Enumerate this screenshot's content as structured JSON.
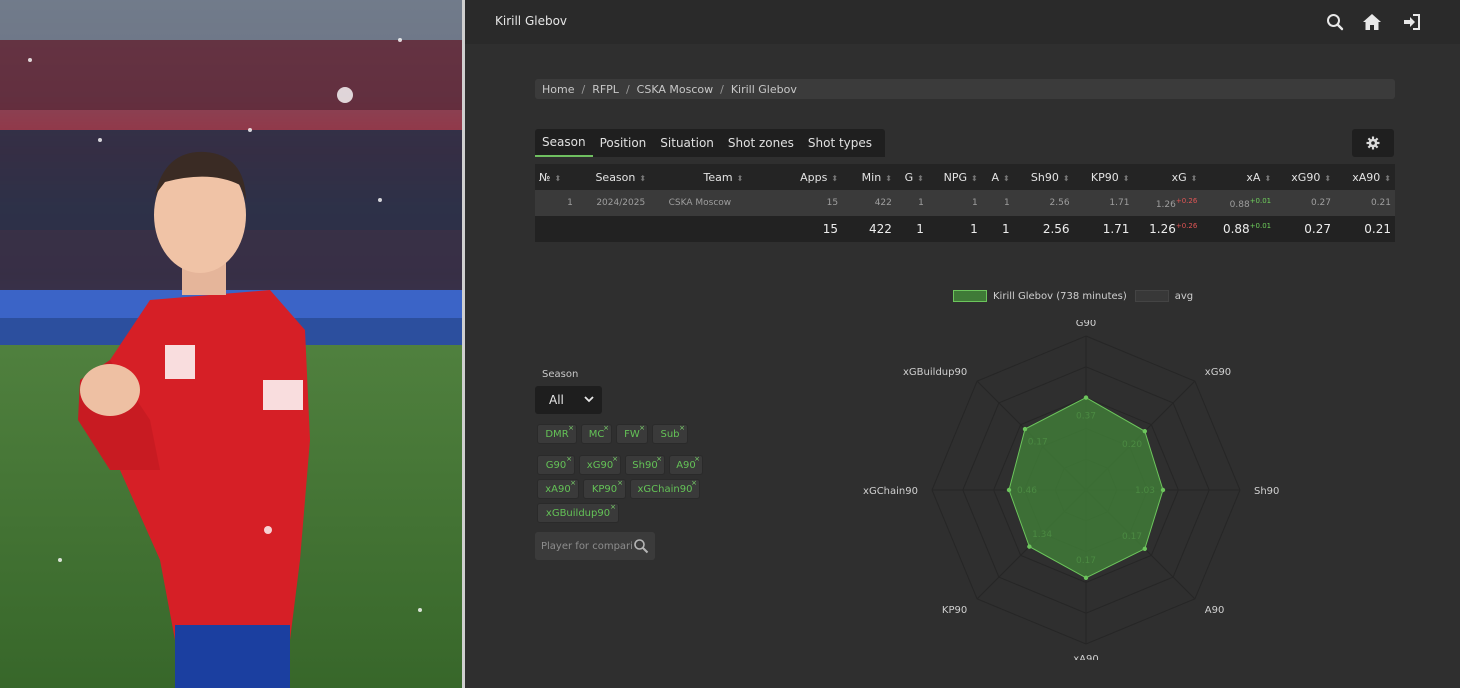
{
  "app": {
    "title": "Kirill Glebov"
  },
  "icons": {
    "search": "search-icon",
    "home": "home-icon",
    "login": "login-icon",
    "settings": "gear-icon",
    "chevron": "chevron-down-icon"
  },
  "colors": {
    "accent": "#6fbf60",
    "radar_fill": "#3f7a37",
    "radar_stroke": "#6cc55c",
    "background": "#2f2f2f",
    "negative": "#e05555"
  },
  "breadcrumb": [
    "Home",
    "RFPL",
    "CSKA Moscow",
    "Kirill Glebov"
  ],
  "breadcrumb_separator": "/",
  "tabs": [
    "Season",
    "Position",
    "Situation",
    "Shot zones",
    "Shot types"
  ],
  "active_tab": "Season",
  "table": {
    "columns": [
      "№",
      "Season",
      "Team",
      "Apps",
      "Min",
      "G",
      "NPG",
      "A",
      "Sh90",
      "KP90",
      "xG",
      "xA",
      "xG90",
      "xA90"
    ],
    "rows": [
      {
        "num": "1",
        "season": "2024/2025",
        "team": "CSKA Moscow",
        "apps": "15",
        "min": "422",
        "g": "1",
        "npg": "1",
        "a": "1",
        "sh90": "2.56",
        "kp90": "1.71",
        "xg": "1.26",
        "xg_diff": "+0.26",
        "xa": "0.88",
        "xa_diff": "+0.01",
        "xg90": "0.27",
        "xa90": "0.21"
      }
    ],
    "total": {
      "apps": "15",
      "min": "422",
      "g": "1",
      "npg": "1",
      "a": "1",
      "sh90": "2.56",
      "kp90": "1.71",
      "xg": "1.26",
      "xg_diff": "+0.26",
      "xa": "0.88",
      "xa_diff": "+0.01",
      "xg90": "0.27",
      "xa90": "0.21"
    }
  },
  "filters": {
    "season_label": "Season",
    "season_value": "All",
    "positions": [
      "DMR",
      "MC",
      "FW",
      "Sub"
    ],
    "metrics": [
      "G90",
      "xG90",
      "Sh90",
      "A90",
      "xA90",
      "KP90",
      "xGChain90",
      "xGBuildup90"
    ],
    "compare_placeholder": "Player for comparison"
  },
  "legend": {
    "player": "Kirill Glebov (738 minutes)",
    "avg": "avg"
  },
  "chart_data": {
    "type": "radar",
    "axes": [
      "G90",
      "xG90",
      "Sh90",
      "A90",
      "xA90",
      "KP90",
      "xGChain90",
      "xGBuildup90"
    ],
    "series": [
      {
        "name": "Kirill Glebov (738 minutes)",
        "values": [
          0.21,
          0.27,
          2.56,
          0.21,
          0.17,
          1.71,
          0.46,
          0.17
        ],
        "labels": [
          "0.37",
          "0.20",
          "1.03",
          "0.17",
          "0.17",
          "1.34",
          "0.46",
          "0.17"
        ]
      }
    ],
    "normalized": [
      0.6,
      0.54,
      0.5,
      0.54,
      0.57,
      0.52,
      0.5,
      0.56
    ]
  }
}
